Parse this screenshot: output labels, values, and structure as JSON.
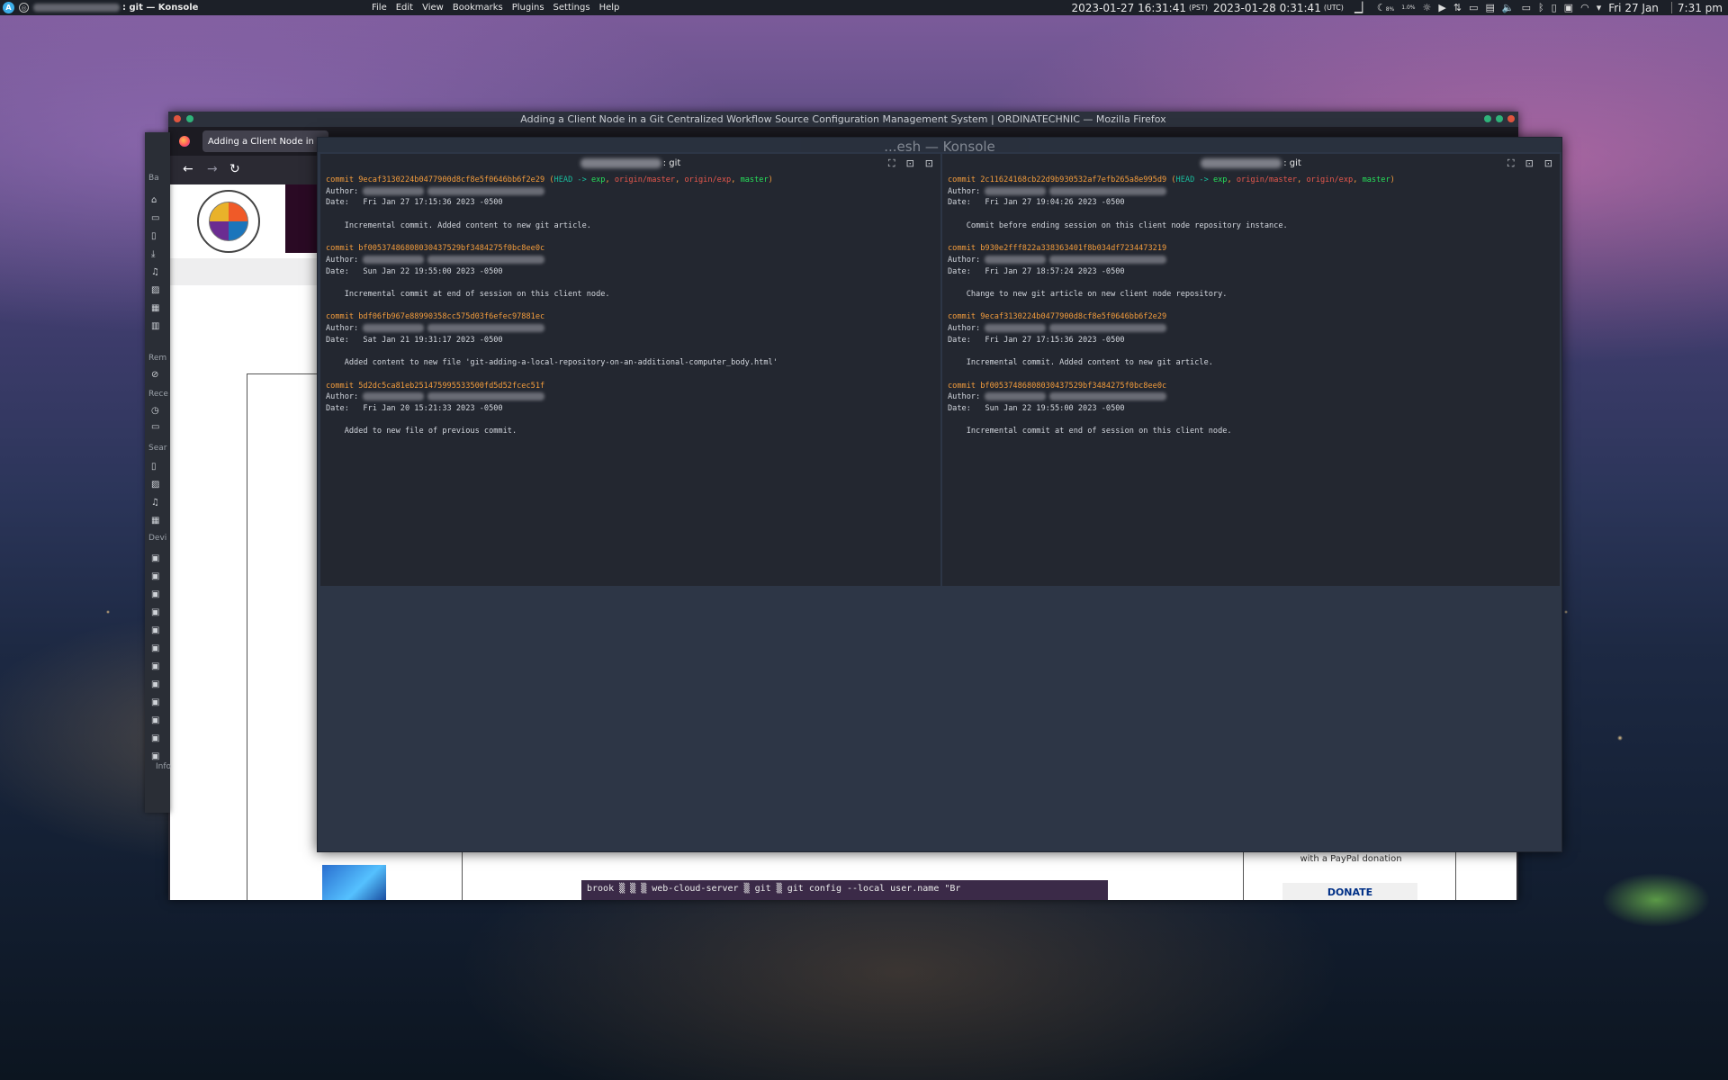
{
  "top_panel": {
    "window_title": ": git — Konsole",
    "menu": [
      "File",
      "Edit",
      "View",
      "Bookmarks",
      "Plugins",
      "Settings",
      "Help"
    ],
    "clock_pst": "2023-01-27 16:31:41",
    "tz_pst": "(PST)",
    "clock_utc": "2023-01-28  0:31:41",
    "tz_utc": "(UTC)",
    "tray_pct_1": "8%",
    "tray_pct_2": "1.0%",
    "date": "Fri 27 Jan",
    "time": "7:31 pm"
  },
  "firefox": {
    "window_title": "Adding a Client Node in a Git Centralized Workflow Source Configuration Management System | ORDINATECHNIC — Mozilla Firefox",
    "tab_title": "Adding a Client Node in a Git C",
    "code_line": "brook ▒  ▒                 ▒ web-cloud-server ▒ git ▒ git config --local user.name \"Br",
    "paypal_text": "with a PayPal donation",
    "donate_label": "DONATE"
  },
  "dolphin": {
    "labels": [
      "Ba",
      "Rem",
      "Rece",
      "Sear",
      "Devi",
      "Info"
    ]
  },
  "konsole": {
    "title_fragment": "...esh — Konsole",
    "left": {
      "title_suffix": ": git",
      "commits": [
        {
          "hash": "commit 9ecaf3130224b0477900d8cf8e5f0646bb6f2e29",
          "refs": true,
          "date": "Date:   Fri Jan 27 17:15:36 2023 -0500",
          "message": "    Incremental commit. Added content to new git article."
        },
        {
          "hash": "commit bf00537486808030437529bf3484275f0bc8ee0c",
          "refs": false,
          "date": "Date:   Sun Jan 22 19:55:00 2023 -0500",
          "message": "    Incremental commit at end of session on this client node."
        },
        {
          "hash": "commit bdf06fb967e88990358cc575d03f6efec97881ec",
          "refs": false,
          "date": "Date:   Sat Jan 21 19:31:17 2023 -0500",
          "message": "    Added content to new file 'git-adding-a-local-repository-on-an-additional-computer_body.html'"
        },
        {
          "hash": "commit 5d2dc5ca81eb251475995533500fd5d52fcec51f",
          "refs": false,
          "date": "Date:   Fri Jan 20 15:21:33 2023 -0500",
          "message": "    Added to new file of previous commit."
        }
      ]
    },
    "right": {
      "title_suffix": ": git",
      "commits": [
        {
          "hash": "commit 2c11624168cb22d9b930532af7efb265a8e995d9",
          "refs": true,
          "date": "Date:   Fri Jan 27 19:04:26 2023 -0500",
          "message": "    Commit before ending session on this client node repository instance."
        },
        {
          "hash": "commit b930e2fff822a338363401f8b034df7234473219",
          "refs": false,
          "date": "Date:   Fri Jan 27 18:57:24 2023 -0500",
          "message": "    Change to new git article on new client node repository."
        },
        {
          "hash": "commit 9ecaf3130224b0477900d8cf8e5f0646bb6f2e29",
          "refs": false,
          "date": "Date:   Fri Jan 27 17:15:36 2023 -0500",
          "message": "    Incremental commit. Added content to new git article."
        },
        {
          "hash": "commit bf00537486808030437529bf3484275f0bc8ee0c",
          "refs": false,
          "date": "Date:   Sun Jan 22 19:55:00 2023 -0500",
          "message": "    Incremental commit at end of session on this client node."
        }
      ]
    },
    "refs": {
      "open": " (",
      "head": "HEAD -> ",
      "exp": "exp",
      "comma": ", ",
      "origin_master": "origin/master",
      "origin_exp": "origin/exp",
      "master": "master",
      "close": ")"
    },
    "author_label": "Author: "
  }
}
